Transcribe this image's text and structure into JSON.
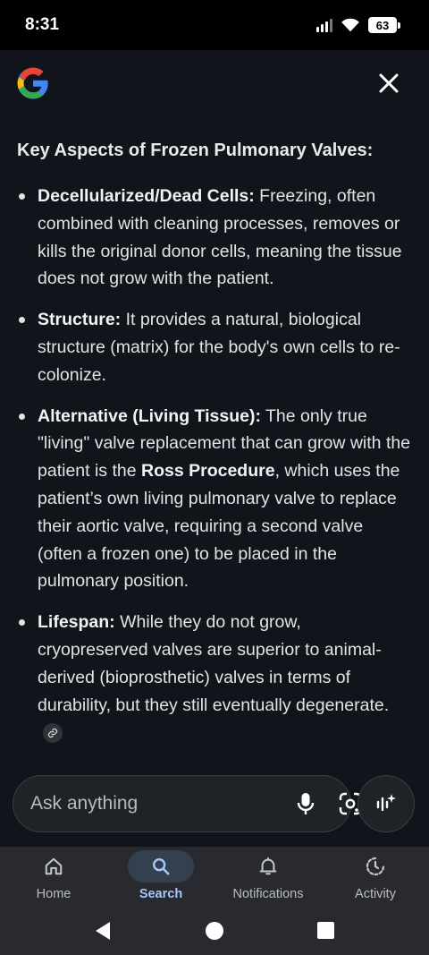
{
  "status_bar": {
    "time": "8:31",
    "battery": "63"
  },
  "header": {
    "logo": "google-g-logo",
    "close_icon": "close-icon"
  },
  "content": {
    "heading": "Key Aspects of Frozen Pulmonary Valves:",
    "bullets": [
      {
        "title": "Decellularized/Dead Cells:",
        "text": " Freezing, often combined with cleaning processes, removes or kills the original donor cells, meaning the tissue does not grow with the patient."
      },
      {
        "title": "Structure:",
        "text": " It provides a natural, biological structure (matrix) for the body's own cells to re-colonize."
      },
      {
        "title": "Alternative (Living Tissue):",
        "text_before": " The only true \"living\" valve replacement that can grow with the patient is the ",
        "emphasis": "Ross Procedure",
        "text_after": ", which uses the patient’s own living pulmonary valve to replace their aortic valve, requiring a second valve (often a frozen one) to be placed in the pulmonary position."
      },
      {
        "title": "Lifespan:",
        "text": " While they do not grow, cryopreserved valves are superior to animal-derived (bioprosthetic) valves in terms of durability, but they still eventually degenerate."
      }
    ]
  },
  "ask_bar": {
    "placeholder": "Ask anything",
    "mic_icon": "mic-icon",
    "lens_icon": "lens-camera-icon",
    "mode_icon": "ai-mode-icon"
  },
  "bottom_nav": {
    "items": [
      {
        "label": "Home",
        "icon": "home-icon"
      },
      {
        "label": "Search",
        "icon": "search-icon",
        "active": true
      },
      {
        "label": "Notifications",
        "icon": "bell-icon"
      },
      {
        "label": "Activity",
        "icon": "activity-icon"
      }
    ]
  },
  "colors": {
    "background": "#11141a",
    "nav_background": "#282a2f",
    "active_accent": "#a8c7fa",
    "active_pill": "#33404f"
  }
}
